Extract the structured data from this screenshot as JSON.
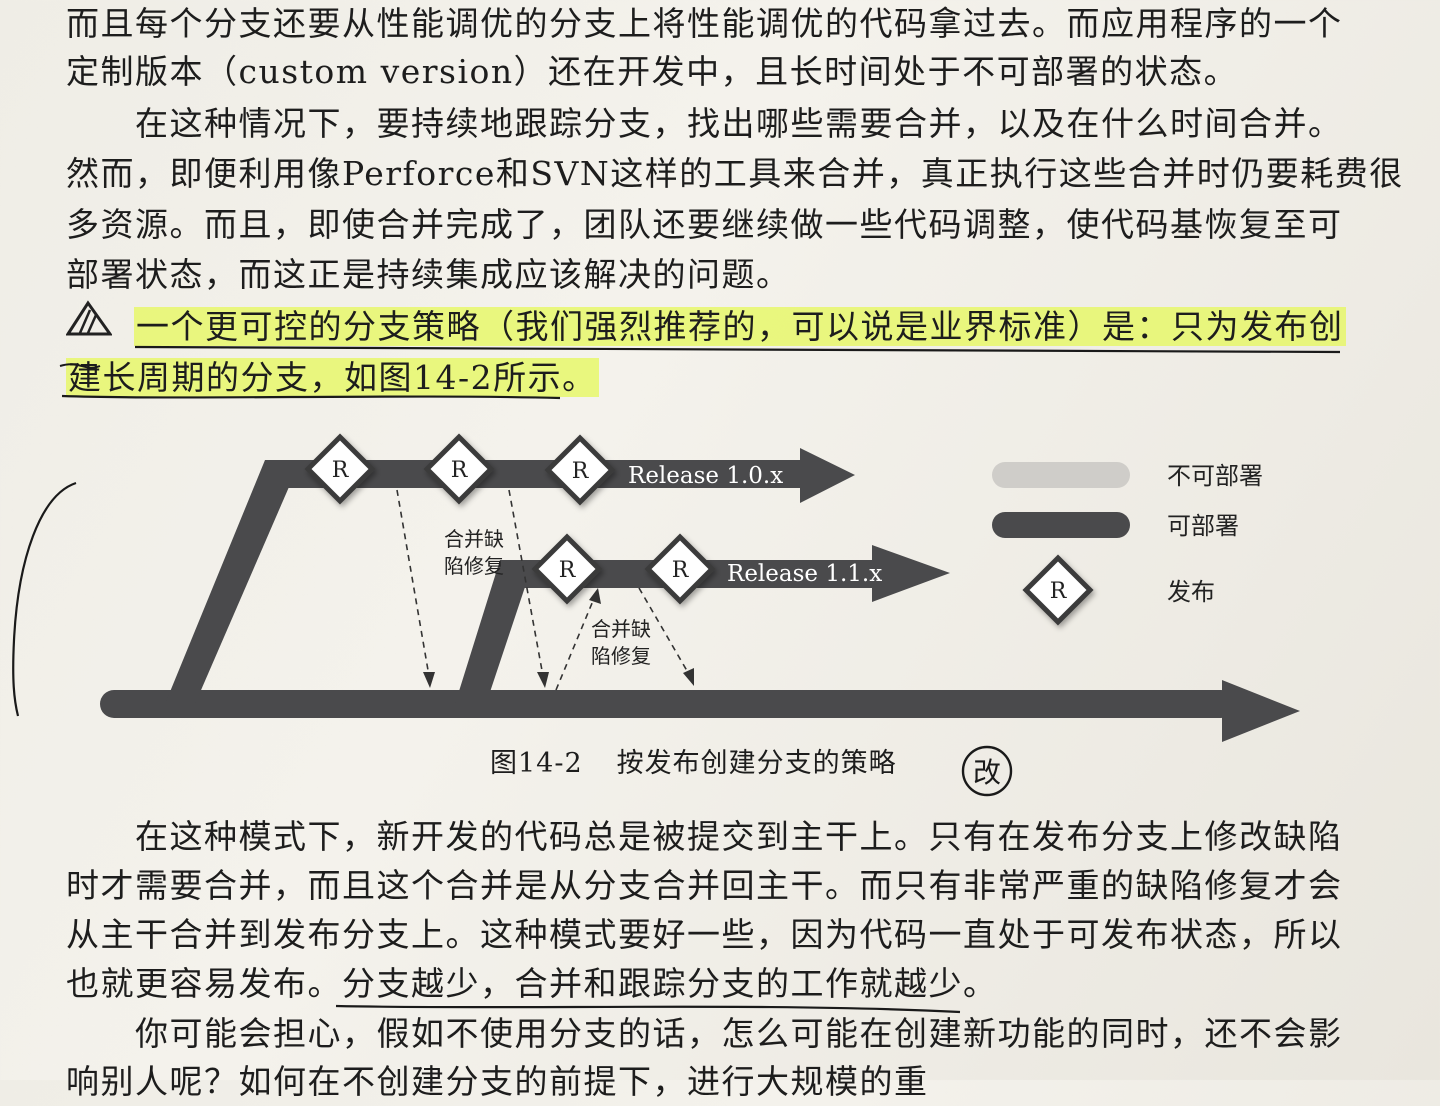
{
  "document": {
    "lines_top": [
      "而且每个分支还要从性能调优的分支上将性能调优的代码拿过去。而应用程序的一个",
      "定制版本（custom version）还在开发中，且长时间处于不可部署的状态。",
      "　　在这种情况下，要持续地跟踪分支，找出哪些需要合并，以及在什么时间合并。",
      "然而，即便利用像Perforce和SVN这样的工具来合并，真正执行这些合并时仍要耗费很",
      "多资源。而且，即使合并完成了，团队还要继续做一些代码调整，使代码基恢复至可",
      "部署状态，而这正是持续集成应该解决的问题。"
    ],
    "highlight_lines": [
      "一个更可控的分支策略（我们强烈推荐的，可以说是业界标准）是：只为发布创",
      "建长周期的分支，如图14-2所示。"
    ],
    "lines_bottom": [
      "　　在这种模式下，新开发的代码总是被提交到主干上。只有在发布分支上修改缺陷",
      "时才需要合并，而且这个合并是从分支合并回主干。而只有非常严重的缺陷修复才会",
      "从主干合并到发布分支上。这种模式要好一些，因为代码一直处于可发布状态，所以",
      "也就更容易发布。分支越少，合并和跟踪分支的工作就越少。",
      "　　你可能会担心，假如不使用分支的话，怎么可能在创建新功能的同时，还不会影",
      "响别人呢？如何在不创建分支的前提下，进行大规模的重"
    ]
  },
  "figure": {
    "caption_number": "图14-2",
    "caption_text": "按发布创建分支的策略",
    "release_marker": "R",
    "branch1_label": "Release 1.0.x",
    "branch2_label": "Release 1.1.x",
    "merge_note_1": [
      "合并缺",
      "陷修复"
    ],
    "merge_note_2": [
      "合并缺",
      "陷修复"
    ],
    "legend": {
      "not_deployable": "不可部署",
      "deployable": "可部署",
      "release": "发布"
    },
    "handwritten_mark": "改"
  },
  "colors": {
    "branch": "#4a4a4c",
    "not_deployable": "#cfcdc9",
    "highlight": "#e6f85a",
    "ink": "#1d1d1d"
  }
}
